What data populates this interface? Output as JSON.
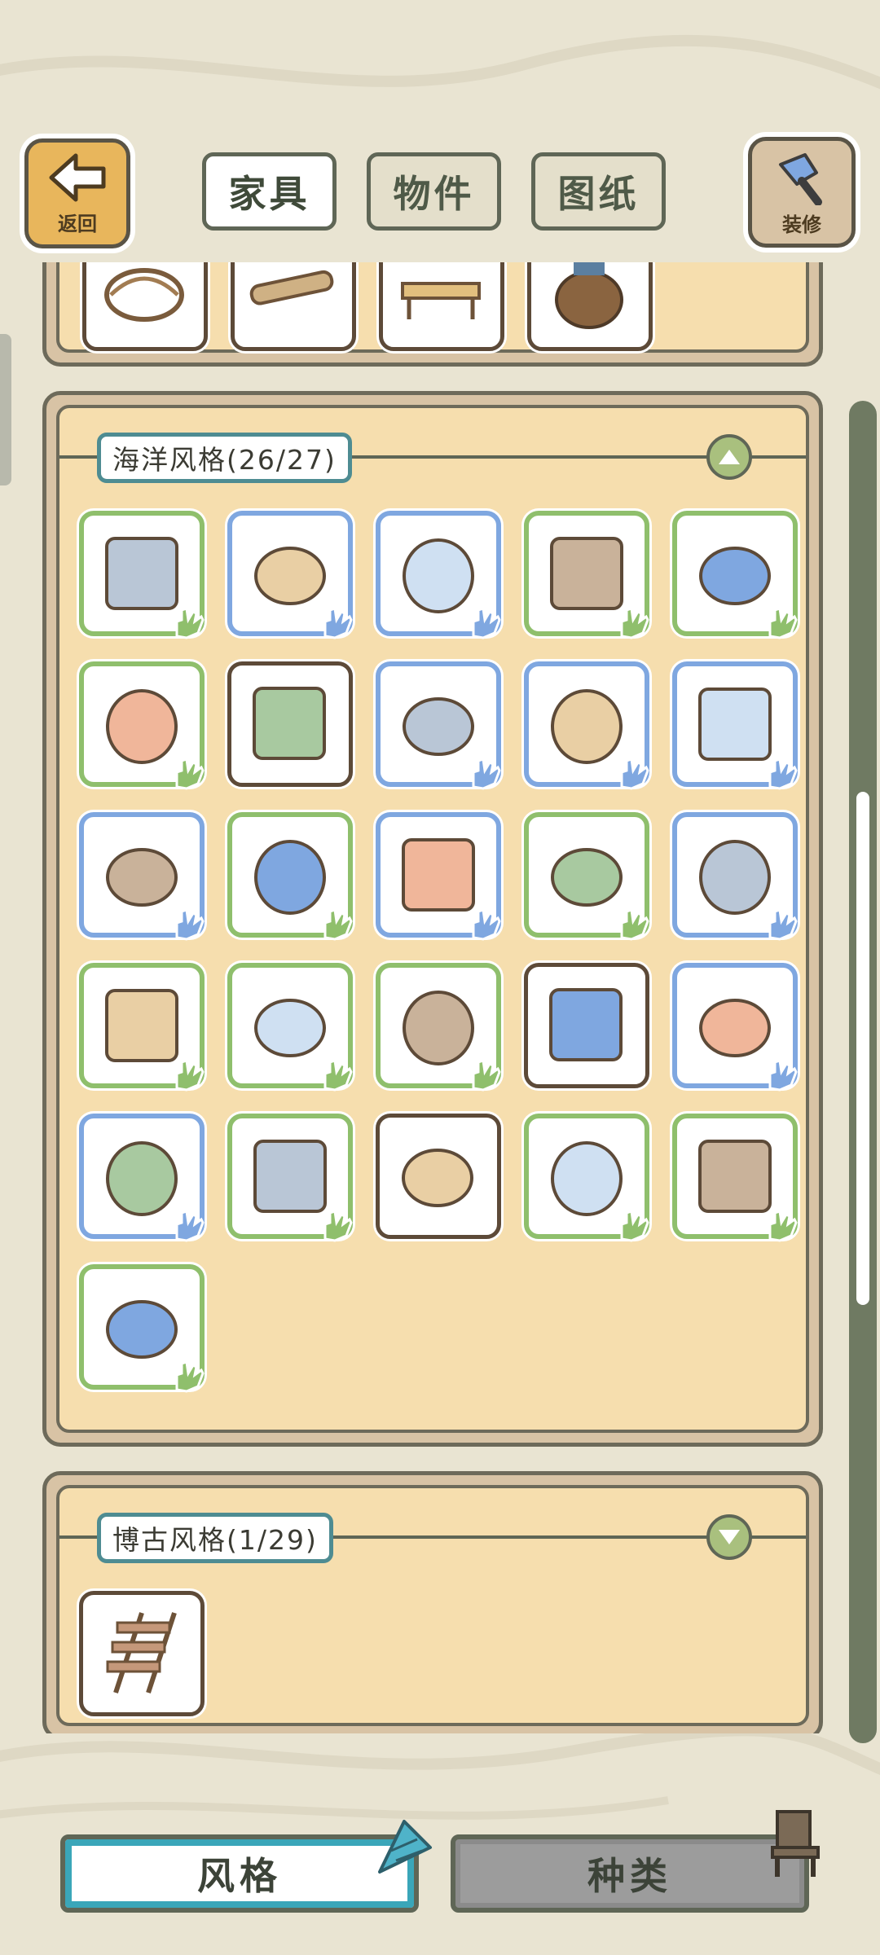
{
  "topbar": {
    "back_label": "返回",
    "decorate_label": "装修",
    "tabs": [
      {
        "label": "家具",
        "active": true
      },
      {
        "label": "物件",
        "active": false
      },
      {
        "label": "图纸",
        "active": false
      }
    ]
  },
  "sections": [
    {
      "title": "海洋风格(26/27)",
      "expanded": true,
      "items": [
        {
          "icon": "stone-wall-bucket",
          "frame": "green"
        },
        {
          "icon": "beach-floor",
          "frame": "blue"
        },
        {
          "icon": "wooden-ladder",
          "frame": "blue"
        },
        {
          "icon": "rock-arch",
          "frame": "green"
        },
        {
          "icon": "round-porthole-mirror",
          "frame": "green"
        },
        {
          "icon": "arched-wooden-door",
          "frame": "green"
        },
        {
          "icon": "treasure-map",
          "frame": "brown"
        },
        {
          "icon": "rolled-scroll",
          "frame": "blue"
        },
        {
          "icon": "ocean-bed",
          "frame": "blue"
        },
        {
          "icon": "sand-jar",
          "frame": "blue"
        },
        {
          "icon": "memo-notes",
          "frame": "blue"
        },
        {
          "icon": "low-wooden-table",
          "frame": "green"
        },
        {
          "icon": "spiral-shell",
          "frame": "blue"
        },
        {
          "icon": "blue-cabinet",
          "frame": "green"
        },
        {
          "icon": "shell-jar",
          "frame": "blue"
        },
        {
          "icon": "blue-treasure-chest",
          "frame": "green"
        },
        {
          "icon": "coral-table",
          "frame": "green"
        },
        {
          "icon": "shell-chair",
          "frame": "green"
        },
        {
          "icon": "rolled-towels",
          "frame": "brown"
        },
        {
          "icon": "blue-desk",
          "frame": "blue"
        },
        {
          "icon": "water-tub",
          "frame": "blue"
        },
        {
          "icon": "arched-mirror",
          "frame": "green"
        },
        {
          "icon": "white-coral",
          "frame": "brown"
        },
        {
          "icon": "folding-screen",
          "frame": "green"
        },
        {
          "icon": "candle-shell",
          "frame": "green"
        },
        {
          "icon": "barrels",
          "frame": "green"
        }
      ]
    },
    {
      "title": "博古风格(1/29)",
      "expanded": false,
      "items": [
        {
          "icon": "wooden-step-ladder",
          "frame": "brown"
        }
      ]
    }
  ],
  "bottom_tabs": [
    {
      "label": "风格",
      "active": true
    },
    {
      "label": "种类",
      "active": false
    }
  ],
  "colors": {
    "background": "#e9e4d2",
    "panel": "#f6deae",
    "frame_green": "#8fbf6c",
    "frame_blue": "#7fa7e0",
    "frame_brown": "#5d4a38",
    "accent_teal": "#3aa6b9"
  }
}
